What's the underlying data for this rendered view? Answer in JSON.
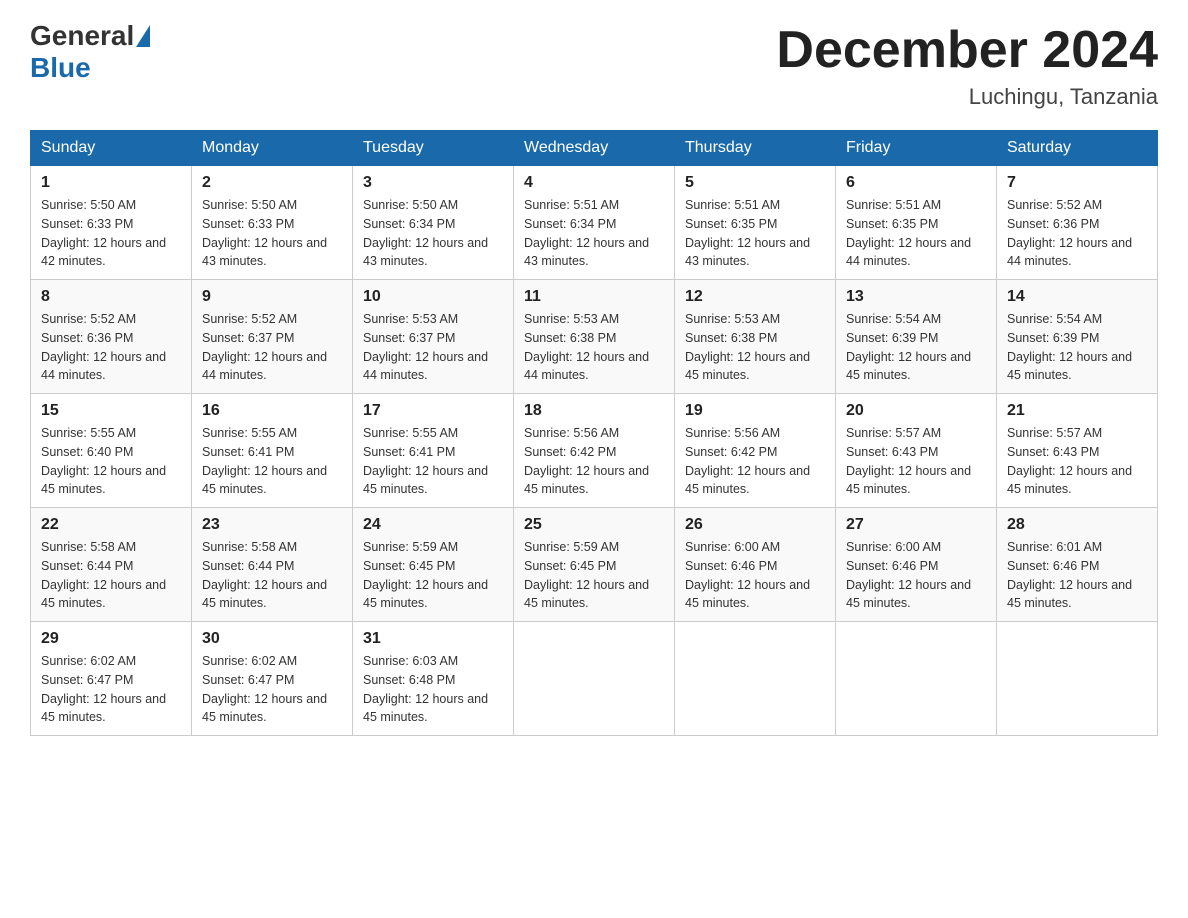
{
  "header": {
    "logo_general": "General",
    "logo_blue": "Blue",
    "month_title": "December 2024",
    "location": "Luchingu, Tanzania"
  },
  "weekdays": [
    "Sunday",
    "Monday",
    "Tuesday",
    "Wednesday",
    "Thursday",
    "Friday",
    "Saturday"
  ],
  "weeks": [
    [
      {
        "day": "1",
        "sunrise": "5:50 AM",
        "sunset": "6:33 PM",
        "daylight": "12 hours and 42 minutes."
      },
      {
        "day": "2",
        "sunrise": "5:50 AM",
        "sunset": "6:33 PM",
        "daylight": "12 hours and 43 minutes."
      },
      {
        "day": "3",
        "sunrise": "5:50 AM",
        "sunset": "6:34 PM",
        "daylight": "12 hours and 43 minutes."
      },
      {
        "day": "4",
        "sunrise": "5:51 AM",
        "sunset": "6:34 PM",
        "daylight": "12 hours and 43 minutes."
      },
      {
        "day": "5",
        "sunrise": "5:51 AM",
        "sunset": "6:35 PM",
        "daylight": "12 hours and 43 minutes."
      },
      {
        "day": "6",
        "sunrise": "5:51 AM",
        "sunset": "6:35 PM",
        "daylight": "12 hours and 44 minutes."
      },
      {
        "day": "7",
        "sunrise": "5:52 AM",
        "sunset": "6:36 PM",
        "daylight": "12 hours and 44 minutes."
      }
    ],
    [
      {
        "day": "8",
        "sunrise": "5:52 AM",
        "sunset": "6:36 PM",
        "daylight": "12 hours and 44 minutes."
      },
      {
        "day": "9",
        "sunrise": "5:52 AM",
        "sunset": "6:37 PM",
        "daylight": "12 hours and 44 minutes."
      },
      {
        "day": "10",
        "sunrise": "5:53 AM",
        "sunset": "6:37 PM",
        "daylight": "12 hours and 44 minutes."
      },
      {
        "day": "11",
        "sunrise": "5:53 AM",
        "sunset": "6:38 PM",
        "daylight": "12 hours and 44 minutes."
      },
      {
        "day": "12",
        "sunrise": "5:53 AM",
        "sunset": "6:38 PM",
        "daylight": "12 hours and 45 minutes."
      },
      {
        "day": "13",
        "sunrise": "5:54 AM",
        "sunset": "6:39 PM",
        "daylight": "12 hours and 45 minutes."
      },
      {
        "day": "14",
        "sunrise": "5:54 AM",
        "sunset": "6:39 PM",
        "daylight": "12 hours and 45 minutes."
      }
    ],
    [
      {
        "day": "15",
        "sunrise": "5:55 AM",
        "sunset": "6:40 PM",
        "daylight": "12 hours and 45 minutes."
      },
      {
        "day": "16",
        "sunrise": "5:55 AM",
        "sunset": "6:41 PM",
        "daylight": "12 hours and 45 minutes."
      },
      {
        "day": "17",
        "sunrise": "5:55 AM",
        "sunset": "6:41 PM",
        "daylight": "12 hours and 45 minutes."
      },
      {
        "day": "18",
        "sunrise": "5:56 AM",
        "sunset": "6:42 PM",
        "daylight": "12 hours and 45 minutes."
      },
      {
        "day": "19",
        "sunrise": "5:56 AM",
        "sunset": "6:42 PM",
        "daylight": "12 hours and 45 minutes."
      },
      {
        "day": "20",
        "sunrise": "5:57 AM",
        "sunset": "6:43 PM",
        "daylight": "12 hours and 45 minutes."
      },
      {
        "day": "21",
        "sunrise": "5:57 AM",
        "sunset": "6:43 PM",
        "daylight": "12 hours and 45 minutes."
      }
    ],
    [
      {
        "day": "22",
        "sunrise": "5:58 AM",
        "sunset": "6:44 PM",
        "daylight": "12 hours and 45 minutes."
      },
      {
        "day": "23",
        "sunrise": "5:58 AM",
        "sunset": "6:44 PM",
        "daylight": "12 hours and 45 minutes."
      },
      {
        "day": "24",
        "sunrise": "5:59 AM",
        "sunset": "6:45 PM",
        "daylight": "12 hours and 45 minutes."
      },
      {
        "day": "25",
        "sunrise": "5:59 AM",
        "sunset": "6:45 PM",
        "daylight": "12 hours and 45 minutes."
      },
      {
        "day": "26",
        "sunrise": "6:00 AM",
        "sunset": "6:46 PM",
        "daylight": "12 hours and 45 minutes."
      },
      {
        "day": "27",
        "sunrise": "6:00 AM",
        "sunset": "6:46 PM",
        "daylight": "12 hours and 45 minutes."
      },
      {
        "day": "28",
        "sunrise": "6:01 AM",
        "sunset": "6:46 PM",
        "daylight": "12 hours and 45 minutes."
      }
    ],
    [
      {
        "day": "29",
        "sunrise": "6:02 AM",
        "sunset": "6:47 PM",
        "daylight": "12 hours and 45 minutes."
      },
      {
        "day": "30",
        "sunrise": "6:02 AM",
        "sunset": "6:47 PM",
        "daylight": "12 hours and 45 minutes."
      },
      {
        "day": "31",
        "sunrise": "6:03 AM",
        "sunset": "6:48 PM",
        "daylight": "12 hours and 45 minutes."
      },
      null,
      null,
      null,
      null
    ]
  ]
}
